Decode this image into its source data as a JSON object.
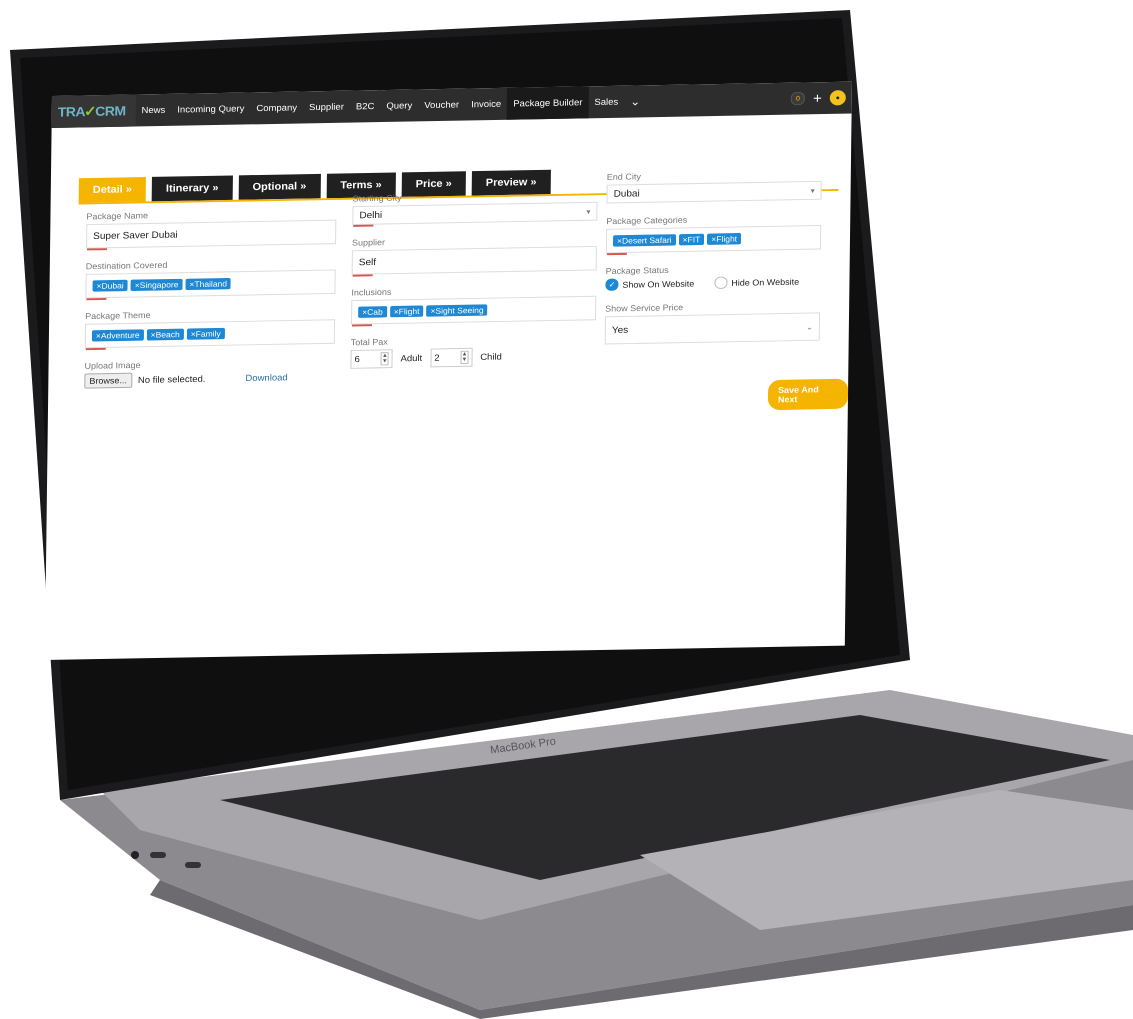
{
  "nav": {
    "logo_prefix": "TRA",
    "logo_suffix": "CRM",
    "items": [
      "News",
      "Incoming Query",
      "Company",
      "Supplier",
      "B2C",
      "Query",
      "Voucher",
      "Invoice",
      "Package Builder",
      "Sales"
    ],
    "active_item": "Package Builder",
    "notification_count": "0",
    "plus_label": "+"
  },
  "tabs": [
    "Detail »",
    "Itinerary »",
    "Optional »",
    "Terms »",
    "Price »",
    "Preview »"
  ],
  "active_tab": "Detail »",
  "form": {
    "package_name": {
      "label": "Package Name",
      "value": "Super Saver Dubai"
    },
    "destination_covered": {
      "label": "Destination Covered",
      "chips": [
        "×Dubai",
        "×Singapore",
        "×Thailand"
      ]
    },
    "package_theme": {
      "label": "Package Theme",
      "chips": [
        "×Adventure",
        "×Beach",
        "×Family"
      ]
    },
    "upload_image": {
      "label": "Upload Image",
      "browse": "Browse...",
      "file_status": "No file selected.",
      "download": "Download"
    },
    "starting_city": {
      "label": "Starting City",
      "value": "Delhi"
    },
    "supplier": {
      "label": "Supplier",
      "value": "Self"
    },
    "inclusions": {
      "label": "Inclusions",
      "chips": [
        "×Cab",
        "×Flight",
        "×Sight Seeing"
      ]
    },
    "total_pax": {
      "label": "Total Pax",
      "adult_value": "6",
      "adult_label": "Adult",
      "child_value": "2",
      "child_label": "Child"
    },
    "end_city": {
      "label": "End City",
      "value": "Dubai"
    },
    "package_categories": {
      "label": "Package Categories",
      "chips": [
        "×Desert Safari",
        "×FIT",
        "×Flight"
      ]
    },
    "package_status": {
      "label": "Package Status",
      "option_on": "Show On Website",
      "option_off": "Hide On Website"
    },
    "show_service_price": {
      "label": "Show Service Price",
      "value": "Yes"
    },
    "save_button": "Save And Next"
  },
  "laptop_label": "MacBook Pro"
}
